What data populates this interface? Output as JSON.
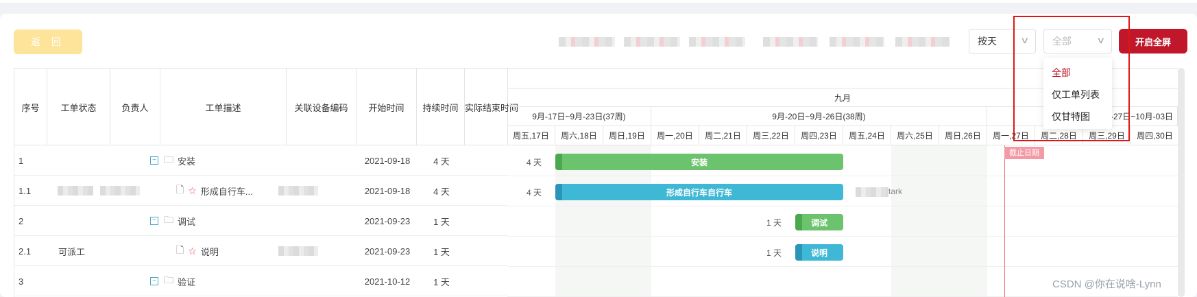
{
  "toolbar": {
    "back_label": "返 回",
    "view_mode_value": "按天",
    "filter_placeholder": "全部",
    "fullscreen_label": "开启全屏"
  },
  "filter_dropdown": {
    "options": [
      {
        "label": "全部",
        "selected": true
      },
      {
        "label": "仅工单列表",
        "selected": false
      },
      {
        "label": "仅甘特图",
        "selected": false
      }
    ]
  },
  "table": {
    "headers": [
      "序号",
      "工单状态",
      "负责人",
      "工单描述",
      "关联设备编码",
      "开始时间",
      "持续时间",
      "实际结束时间"
    ],
    "rows": [
      {
        "index": "1",
        "status": "",
        "desc": "安装",
        "type": "folder",
        "start": "2021-09-18",
        "duration": "4 天"
      },
      {
        "index": "1.1",
        "status": "",
        "desc": "形成自行车...",
        "type": "file",
        "start": "2021-09-18",
        "duration": "4 天"
      },
      {
        "index": "2",
        "status": "",
        "desc": "调试",
        "type": "folder",
        "start": "2021-09-23",
        "duration": "1 天"
      },
      {
        "index": "2.1",
        "status": "可派工",
        "desc": "说明",
        "type": "file",
        "start": "2021-09-23",
        "duration": "1 天"
      },
      {
        "index": "3",
        "status": "",
        "desc": "验证",
        "type": "folder",
        "start": "2021-10-12",
        "duration": "1 天"
      }
    ]
  },
  "gantt": {
    "month": "九月",
    "weeks": [
      "9月-17日~9月-23日(37周)",
      "9月-20日~9月-26日(38周)",
      "9月-27日~10月-03日"
    ],
    "days": [
      "周五,17日",
      "周六,18日",
      "周日,19日",
      "周一,20日",
      "周二,21日",
      "周三,22日",
      "周四,23日",
      "周五,24日",
      "周六,25日",
      "周日,26日",
      "周一,27日",
      "周二,28日",
      "周三,29日",
      "周四,30日"
    ],
    "bars": [
      {
        "label": "安装",
        "duration": "4 天",
        "color": "#6cc36e"
      },
      {
        "label": "形成自行车自行车",
        "duration": "4 天",
        "color": "#3fb8d5",
        "trailing": "tark"
      },
      {
        "label": "调试",
        "duration": "1 天",
        "color": "#6cc36e"
      },
      {
        "label": "说明",
        "duration": "1 天",
        "color": "#3fb8d5"
      }
    ],
    "deadline_label": "截止日期",
    "deadline_color": "#f06b78"
  },
  "watermark": "CSDN @你在说啥-Lynn",
  "colors": {
    "accent": "#c0172b",
    "back_button": "#fde49a",
    "highlight": "#e01515"
  }
}
